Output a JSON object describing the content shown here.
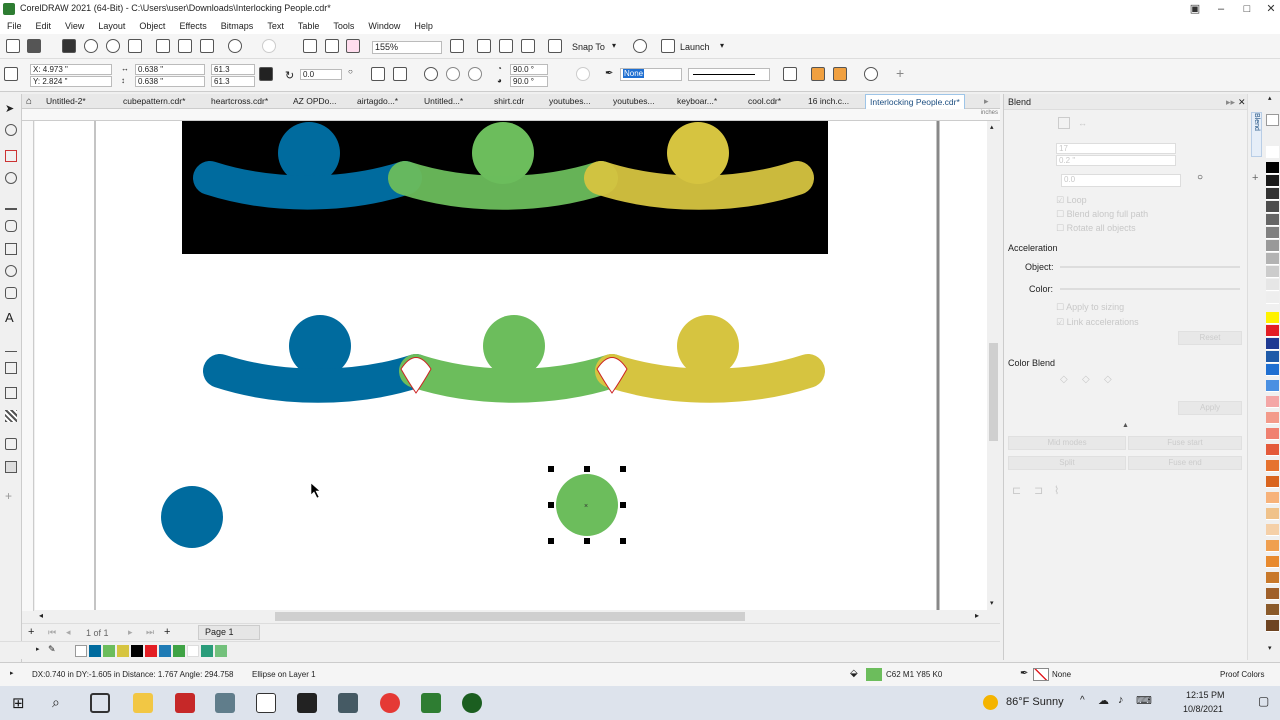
{
  "window": {
    "title": "CorelDRAW 2021 (64-Bit) - C:\\Users\\user\\Downloads\\Interlocking People.cdr*"
  },
  "menu": [
    "File",
    "Edit",
    "View",
    "Layout",
    "Object",
    "Effects",
    "Bitmaps",
    "Text",
    "Table",
    "Tools",
    "Window",
    "Help"
  ],
  "toolbar": {
    "zoom": "155%",
    "snap_to": "Snap To",
    "launch": "Launch"
  },
  "property_bar": {
    "x": "X: 4.973 \"",
    "y": "Y: 2.824 \"",
    "w": "0.638 \"",
    "h": "0.638 \"",
    "sx": "61.3",
    "sy": "61.3",
    "rotation": "0.0",
    "angle1": "90.0 °",
    "angle2": "90.0 °",
    "outline": "None"
  },
  "tabs": [
    "Untitled-2*",
    "cubepattern.cdr*",
    "heartcross.cdr*",
    "AZ OPDo...",
    "airtagdo...*",
    "Untitled...*",
    "shirt.cdr",
    "youtubes...",
    "youtubes...",
    "keyboar...*",
    "cool.cdr*",
    "16 inch.c...",
    "Interlocking People.cdr*"
  ],
  "ruler": {
    "unit": "inches"
  },
  "colors": {
    "blue": "#006b9e",
    "green": "#6cbd5c",
    "yellow": "#d6c440",
    "black": "#000000"
  },
  "pagebar": {
    "page_count": "1 of 1",
    "page_tab": "Page 1"
  },
  "docker": {
    "title": "Blend",
    "steps": "17",
    "spacing": "0.2 \"",
    "angle": "0.0",
    "loop": "Loop",
    "blend_full_path": "Blend along full path",
    "rotate_all": "Rotate all objects",
    "acceleration": "Acceleration",
    "object": "Object:",
    "color": "Color:",
    "apply_size": "Apply to sizing",
    "link_acc": "Link accelerations",
    "reset": "Reset",
    "color_blend": "Color Blend",
    "apply": "Apply",
    "more_modes": "Mid modes",
    "fuse_start": "Fuse start",
    "split": "Split",
    "fuse_end": "Fuse end"
  },
  "status": {
    "left": "DX:0.740 in DY:-1.605 in Distance: 1.767 Angle: 294.758",
    "object": "Ellipse on Layer 1",
    "fill": "C62 M1 Y85 K0",
    "outline": "None",
    "proof": "Proof Colors"
  },
  "taskbar": {
    "weather": "86°F  Sunny",
    "time": "12:15 PM",
    "date": "10/8/2021"
  }
}
